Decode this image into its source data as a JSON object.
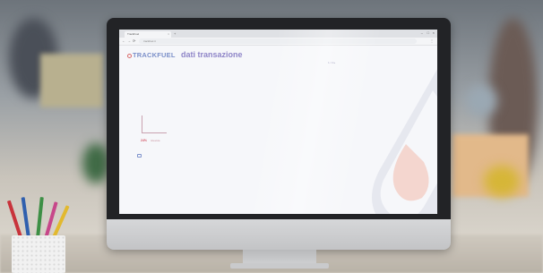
{
  "browser": {
    "tab_title": "TrackFuel",
    "tab_close": "×",
    "new_tab": "+",
    "window_controls": [
      "–",
      "□",
      "×"
    ],
    "nav": [
      "←",
      "→",
      "⟳"
    ],
    "url": "trackfuel.it",
    "menu": "⋮"
  },
  "app": {
    "logo_text": "TRACKFUEL",
    "page_title": "dati transazione",
    "pager": "1 / 2 ▸",
    "kpi_value": "24%",
    "kpi_caption": "ricevute",
    "footer_note": "· · ·"
  },
  "colors": {
    "brand_blue": "#7c90c9",
    "title_purple": "#8f86c8",
    "accent_red": "#d45a6a"
  }
}
